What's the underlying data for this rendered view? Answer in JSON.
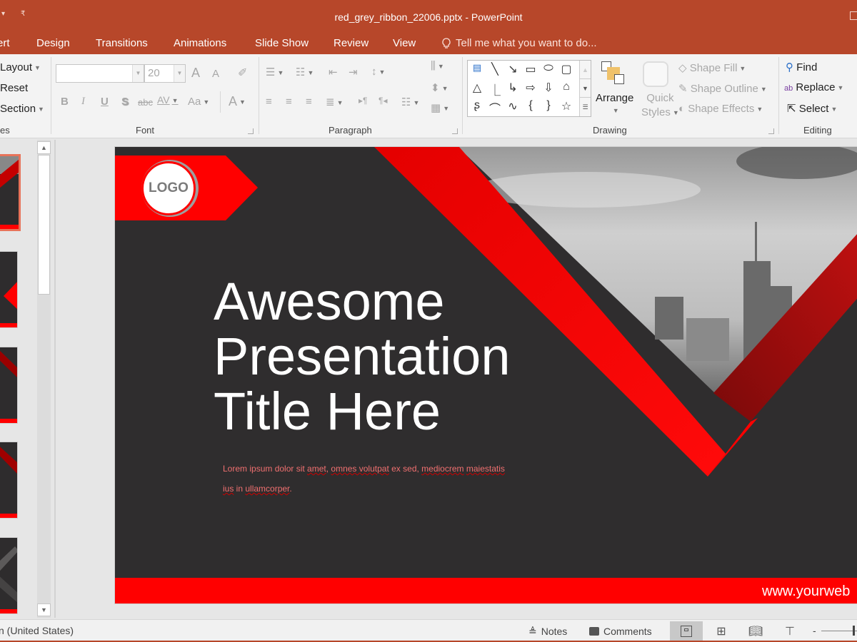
{
  "window": {
    "title": "red_grey_ribbon_22006.pptx - PowerPoint",
    "qat": [
      "▾",
      "₹"
    ]
  },
  "tabs": [
    {
      "label": "ert",
      "active": false
    },
    {
      "label": "Design",
      "active": false
    },
    {
      "label": "Transitions",
      "active": false
    },
    {
      "label": "Animations",
      "active": false
    },
    {
      "label": "Slide Show",
      "active": false
    },
    {
      "label": "Review",
      "active": false
    },
    {
      "label": "View",
      "active": false
    }
  ],
  "tell_me": {
    "placeholder": "Tell me what you want to do...",
    "icon": "lightbulb-icon"
  },
  "ribbon": {
    "slides_group": {
      "label": "es",
      "layout": "Layout",
      "reset": "Reset",
      "section": "Section"
    },
    "font_group": {
      "label": "Font",
      "font_name": "",
      "font_size": "20",
      "increase_size": "A",
      "decrease_size": "A",
      "bold": "B",
      "italic": "I",
      "underline": "U",
      "shadow": "S",
      "strikethrough": "abc",
      "char_spacing": "AV",
      "change_case": "Aa",
      "font_color": "A"
    },
    "paragraph_group": {
      "label": "Paragraph"
    },
    "drawing_group": {
      "label": "Drawing",
      "arrange": "Arrange",
      "quick_styles": [
        "Quick",
        "Styles"
      ],
      "shape_fill": "Shape Fill",
      "shape_outline": "Shape Outline",
      "shape_effects": "Shape Effects",
      "shapes": [
        "text-box",
        "line",
        "arrow-line",
        "rectangle",
        "oval",
        "rounded-rectangle",
        "triangle",
        "elbow-connector",
        "elbow-arrow",
        "right-arrow",
        "down-arrow",
        "snip-shape",
        "freeform",
        "arc",
        "curve",
        "left-brace",
        "right-brace",
        "star"
      ]
    },
    "editing_group": {
      "label": "Editing",
      "find": "Find",
      "replace": "Replace",
      "select": "Select"
    }
  },
  "thumbnails": [
    {
      "index": 1,
      "active": true
    },
    {
      "index": 2,
      "active": false
    },
    {
      "index": 3,
      "active": false
    },
    {
      "index": 4,
      "active": false
    },
    {
      "index": 5,
      "active": false
    }
  ],
  "slide": {
    "logo": "LOGO",
    "title": "Awesome\nPresentation\nTitle Here",
    "body": {
      "segments": [
        {
          "text": "Lorem ipsum dolor sit ",
          "misspelled": false
        },
        {
          "text": "amet",
          "misspelled": true
        },
        {
          "text": ", ",
          "misspelled": false
        },
        {
          "text": "omnes volutpat",
          "misspelled": true
        },
        {
          "text": " ex sed, ",
          "misspelled": false
        },
        {
          "text": "mediocrem",
          "misspelled": true
        },
        {
          "text": " ",
          "misspelled": false
        },
        {
          "text": "maiestatis ius",
          "misspelled": true
        },
        {
          "text": " in ",
          "misspelled": false
        },
        {
          "text": "ullamcorper",
          "misspelled": true
        },
        {
          "text": ".",
          "misspelled": false
        }
      ]
    },
    "website": "www.yourweb",
    "colors": {
      "background": "#2f2d2e",
      "accent": "#ff0000",
      "ribbon_dark": "#a00d0d"
    }
  },
  "statusbar": {
    "language": "n (United States)",
    "notes": "Notes",
    "comments": "Comments",
    "views": [
      "normal-view",
      "slide-sorter-view",
      "reading-view",
      "slideshow-view"
    ],
    "active_view": "normal-view",
    "zoom_minus": "-",
    "zoom_fraction": 0.75
  },
  "theme": {
    "accent": "#b7472a"
  }
}
